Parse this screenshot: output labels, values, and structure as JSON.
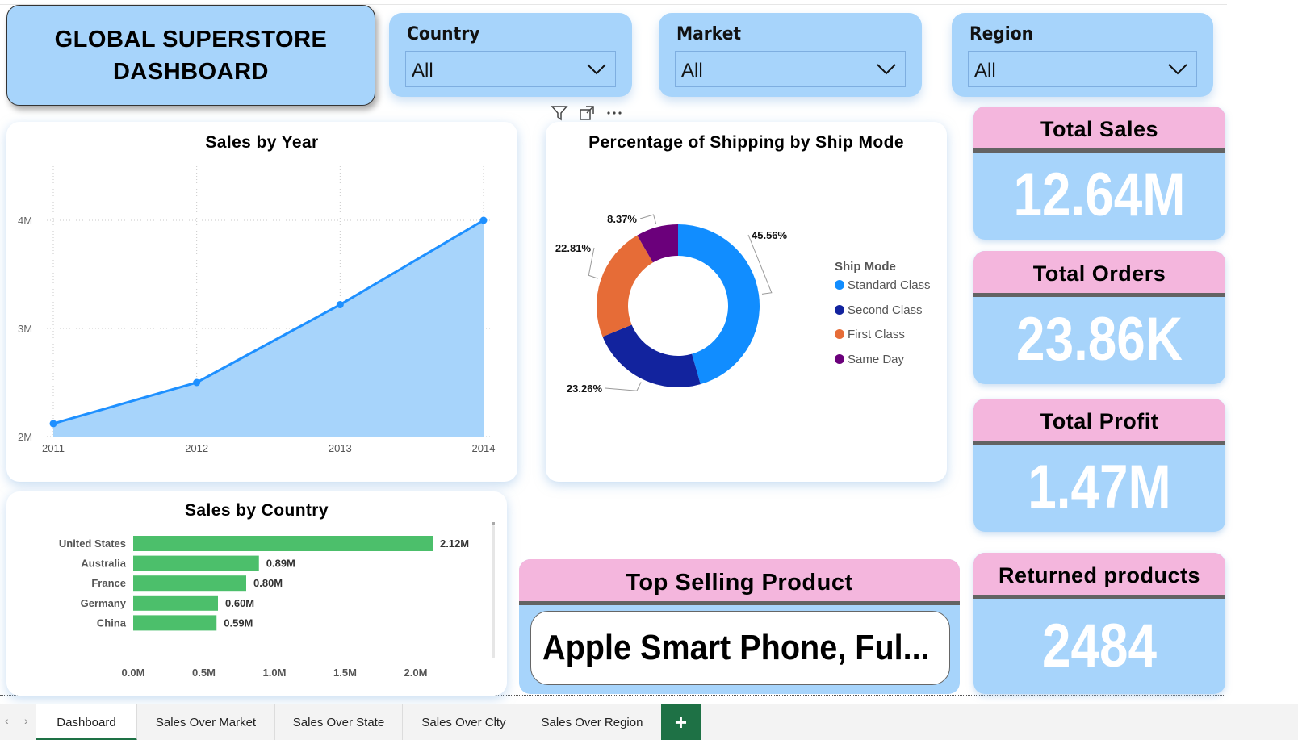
{
  "title": {
    "line1": "GLOBAL SUPERSTORE",
    "line2": "DASHBOARD"
  },
  "slicers": {
    "country": {
      "label": "Country",
      "value": "All"
    },
    "market": {
      "label": "Market",
      "value": "All"
    },
    "region": {
      "label": "Region",
      "value": "All"
    }
  },
  "visual_icons": [
    "filter-icon",
    "focus-mode-icon",
    "more-options-icon"
  ],
  "kpis": {
    "total_sales": {
      "label": "Total Sales",
      "value": "12.64M"
    },
    "total_orders": {
      "label": "Total Orders",
      "value": "23.86K"
    },
    "total_profit": {
      "label": "Total Profit",
      "value": "1.47M"
    },
    "returned_products": {
      "label": "Returned products",
      "value": "2484"
    }
  },
  "top_selling": {
    "label": "Top Selling Product",
    "value": "Apple Smart Phone, Ful..."
  },
  "colors": {
    "slicer_bg": "#a7d4fb",
    "kpi_head": "#f4b6dd",
    "bar_green": "#4cbf6b",
    "line_blue": "#1e90ff",
    "tab_green": "#1e7145"
  },
  "tabs": {
    "items": [
      "Dashboard",
      "Sales Over Market",
      "Sales Over State",
      "Sales Over Clty",
      "Sales Over Region"
    ],
    "active": "Dashboard",
    "add_label": "+"
  },
  "chart_data": [
    {
      "type": "area",
      "title": "Sales by Year",
      "x": [
        "2011",
        "2012",
        "2013",
        "2014"
      ],
      "values": [
        2.12,
        2.5,
        3.22,
        4.0
      ],
      "unit": "M",
      "ylim": [
        2,
        4.5
      ],
      "yticks": [
        "2M",
        "3M",
        "4M"
      ],
      "grid": true,
      "color": "#1e90ff",
      "fill": "#a7d4fb"
    },
    {
      "type": "pie",
      "donut": true,
      "title": "Percentage of Shipping by Ship Mode",
      "legend_title": "Ship Mode",
      "legend_position": "right",
      "slices": [
        {
          "name": "Standard Class",
          "value": 45.56,
          "label": "45.56%",
          "color": "#118dff"
        },
        {
          "name": "Second Class",
          "value": 23.26,
          "label": "23.26%",
          "color": "#12239e"
        },
        {
          "name": "First Class",
          "value": 22.81,
          "label": "22.81%",
          "color": "#e66c37"
        },
        {
          "name": "Same Day",
          "value": 8.37,
          "label": "8.37%",
          "color": "#6b007b"
        }
      ]
    },
    {
      "type": "bar",
      "orientation": "horizontal",
      "title": "Sales by Country",
      "categories": [
        "United States",
        "Australia",
        "France",
        "Germany",
        "China"
      ],
      "values": [
        2.12,
        0.89,
        0.8,
        0.6,
        0.59
      ],
      "data_labels": [
        "2.12M",
        "0.89M",
        "0.80M",
        "0.60M",
        "0.59M"
      ],
      "xlim": [
        0,
        2.4
      ],
      "xticks": [
        "0.0M",
        "0.5M",
        "1.0M",
        "1.5M",
        "2.0M"
      ],
      "color": "#4cbf6b"
    }
  ]
}
